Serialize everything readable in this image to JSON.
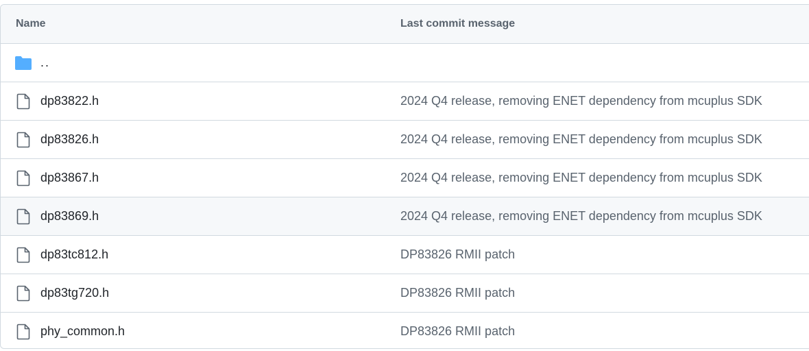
{
  "table": {
    "headers": {
      "name": "Name",
      "message": "Last commit message"
    },
    "parent": {
      "label": ".."
    },
    "rows": [
      {
        "name": "dp83822.h",
        "message": "2024 Q4 release, removing ENET dependency from mcuplus SDK",
        "icon": "file-icon"
      },
      {
        "name": "dp83826.h",
        "message": "2024 Q4 release, removing ENET dependency from mcuplus SDK",
        "icon": "file-icon"
      },
      {
        "name": "dp83867.h",
        "message": "2024 Q4 release, removing ENET dependency from mcuplus SDK",
        "icon": "file-icon"
      },
      {
        "name": "dp83869.h",
        "message": "2024 Q4 release, removing ENET dependency from mcuplus SDK",
        "icon": "file-icon",
        "hovered": true
      },
      {
        "name": "dp83tc812.h",
        "message": "DP83826 RMII patch",
        "icon": "file-icon"
      },
      {
        "name": "dp83tg720.h",
        "message": "DP83826 RMII patch",
        "icon": "file-icon"
      },
      {
        "name": "phy_common.h",
        "message": "DP83826 RMII patch",
        "icon": "file-icon"
      }
    ]
  },
  "colors": {
    "folder": "#54aeff",
    "border": "#d1d9e0",
    "header_bg": "#f6f8fa",
    "muted_text": "#59636e",
    "text": "#1f2328"
  }
}
